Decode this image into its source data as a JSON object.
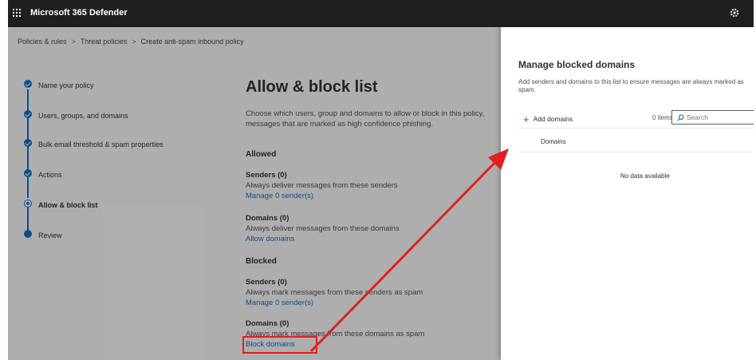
{
  "app": {
    "title": "Microsoft 365 Defender"
  },
  "breadcrumb": [
    "Policies & rules",
    "Threat policies",
    "Create anti-spam inbound policy"
  ],
  "steps": [
    {
      "label": "Name your policy",
      "state": "done"
    },
    {
      "label": "Users, groups, and domains",
      "state": "done"
    },
    {
      "label": "Bulk email threshold & spam properties",
      "state": "done"
    },
    {
      "label": "Actions",
      "state": "done"
    },
    {
      "label": "Allow & block list",
      "state": "current"
    },
    {
      "label": "Review",
      "state": "todo"
    }
  ],
  "main": {
    "title": "Allow & block list",
    "description": "Choose which users, group and domains to allow or block in this policy, messages that are marked as high confidence phishing.",
    "allowed_heading": "Allowed",
    "allowed_senders": {
      "title": "Senders (0)",
      "desc": "Always deliver messages from these senders",
      "link": "Manage 0 sender(s)"
    },
    "allowed_domains": {
      "title": "Domains (0)",
      "desc": "Always deliver messages from these domains",
      "link": "Allow domains"
    },
    "blocked_heading": "Blocked",
    "blocked_senders": {
      "title": "Senders (0)",
      "desc": "Always mark messages from these senders as spam",
      "link": "Manage 0 sender(s)"
    },
    "blocked_domains": {
      "title": "Domains (0)",
      "desc": "Always mark messages from these domains as spam",
      "link": "Block domains"
    }
  },
  "panel": {
    "title": "Manage blocked domains",
    "description": "Add senders and domains to this list to ensure messages are always marked as spam.",
    "add_label": "Add domains",
    "count": "0 items",
    "search_placeholder": "Search",
    "column_header": "Domains",
    "empty_text": "No data available"
  },
  "colors": {
    "accent": "#0f6cbd",
    "annotation": "#e02020",
    "topbar": "#1f1f1f"
  },
  "icons": [
    "waffle-icon",
    "gear-icon",
    "check-icon",
    "plus-icon",
    "search-icon"
  ]
}
